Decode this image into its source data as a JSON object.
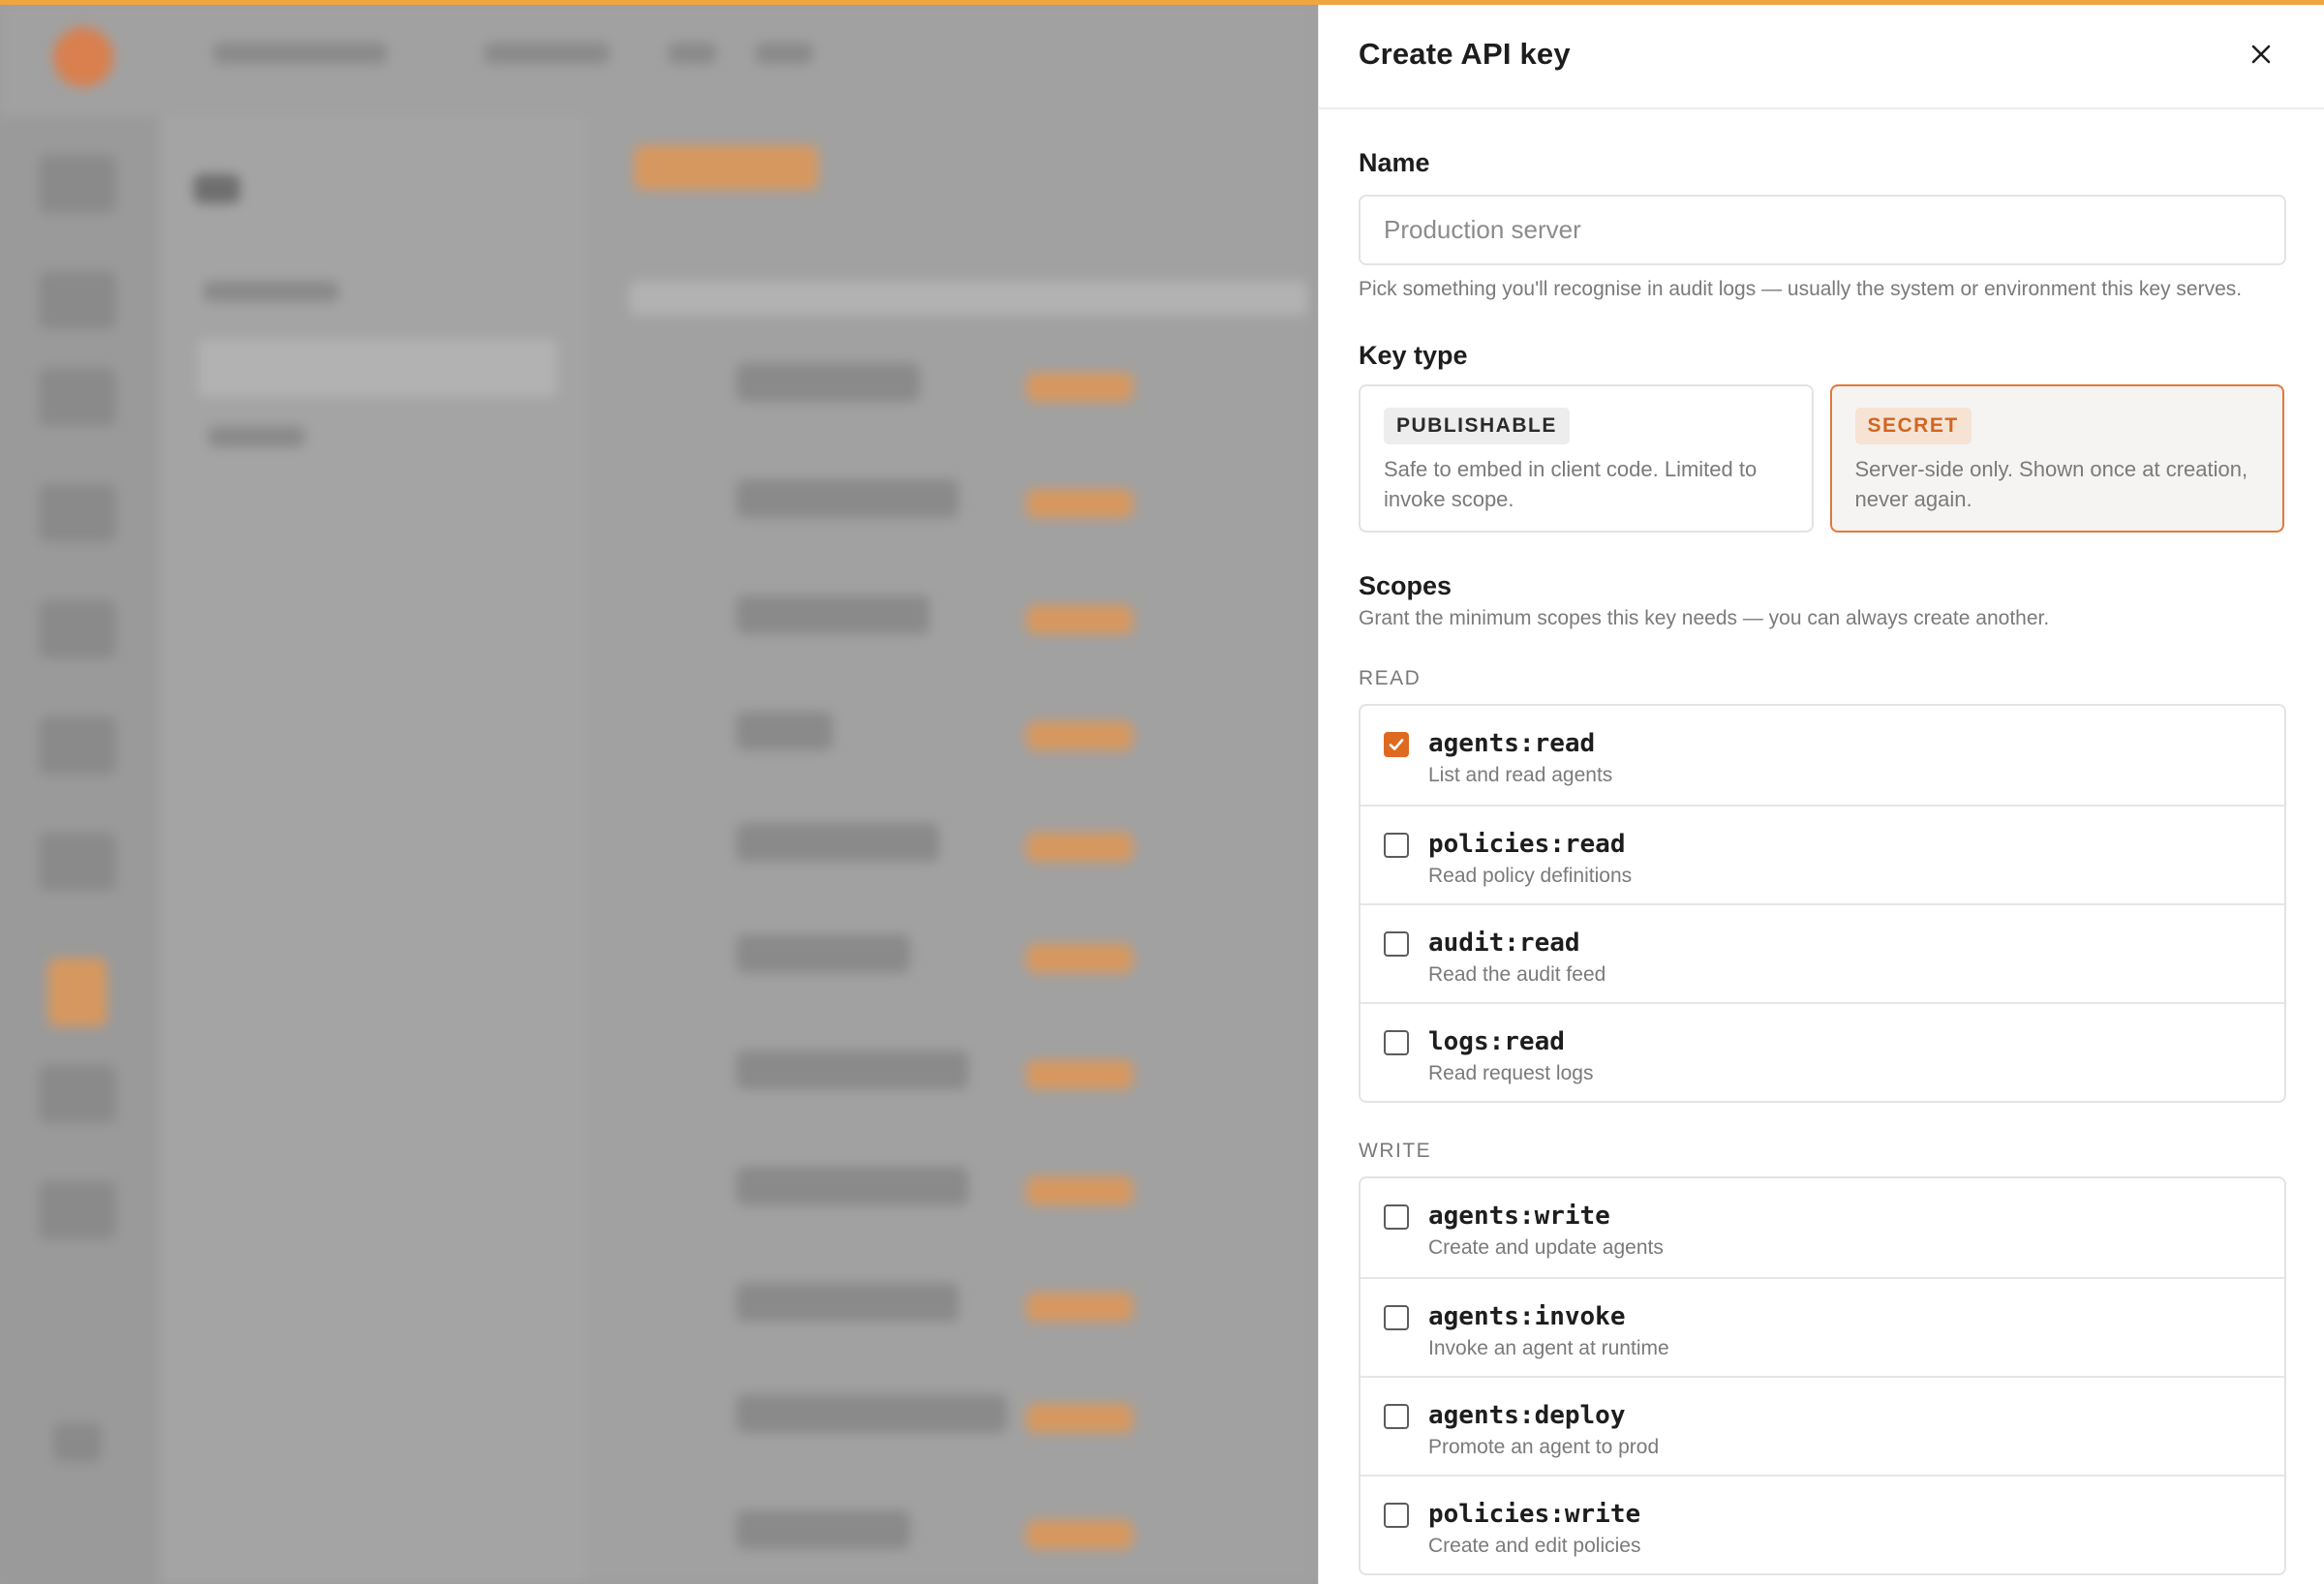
{
  "drawer": {
    "title": "Create API key",
    "name_label": "Name",
    "name_placeholder": "Production server",
    "name_value": "",
    "name_help": "Pick something you'll recognise in audit logs — usually the system or environment this key serves.",
    "key_type_label": "Key type",
    "key_types": [
      {
        "badge": "PUBLISHABLE",
        "description": "Safe to embed in client code. Limited to invoke scope.",
        "selected": false
      },
      {
        "badge": "SECRET",
        "description": "Server-side only. Shown once at creation, never again.",
        "selected": true
      }
    ],
    "scopes_label": "Scopes",
    "scopes_help": "Grant the minimum scopes this key needs — you can always create another.",
    "read_label": "READ",
    "read_scopes": [
      {
        "name": "agents:read",
        "description": "List and read agents",
        "checked": true
      },
      {
        "name": "policies:read",
        "description": "Read policy definitions",
        "checked": false
      },
      {
        "name": "audit:read",
        "description": "Read the audit feed",
        "checked": false
      },
      {
        "name": "logs:read",
        "description": "Read request logs",
        "checked": false
      }
    ],
    "write_label": "WRITE",
    "write_scopes": [
      {
        "name": "agents:write",
        "description": "Create and update agents",
        "checked": false
      },
      {
        "name": "agents:invoke",
        "description": "Invoke an agent at runtime",
        "checked": false
      },
      {
        "name": "agents:deploy",
        "description": "Promote an agent to prod",
        "checked": false
      },
      {
        "name": "policies:write",
        "description": "Create and edit policies",
        "checked": false
      }
    ]
  },
  "colors": {
    "accent": "#de6a22",
    "top_bar": "#f0a640"
  },
  "icons": {
    "close": "close-icon",
    "check": "check-icon"
  }
}
